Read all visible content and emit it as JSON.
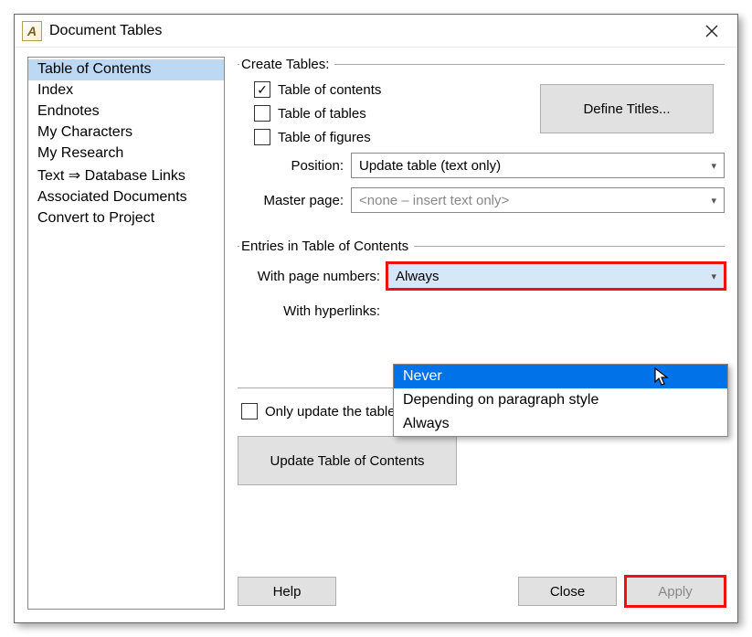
{
  "window": {
    "title": "Document Tables"
  },
  "sidebar": {
    "items": [
      {
        "label": "Table of Contents",
        "selected": true
      },
      {
        "label": "Index"
      },
      {
        "label": "Endnotes"
      },
      {
        "label": "My Characters"
      },
      {
        "label": "My Research"
      },
      {
        "label": "Text ⇒ Database Links"
      },
      {
        "label": "Associated Documents"
      },
      {
        "label": "Convert to Project"
      }
    ]
  },
  "create": {
    "legend": "Create Tables:",
    "toc": {
      "label": "Table of contents",
      "checked": true
    },
    "tot": {
      "label": "Table of tables",
      "checked": false
    },
    "tof": {
      "label": "Table of figures",
      "checked": false
    },
    "define": "Define Titles...",
    "position_label": "Position:",
    "position_value": "Update table (text only)",
    "master_label": "Master page:",
    "master_value": "<none – insert text only>"
  },
  "entries": {
    "legend": "Entries in Table of Contents",
    "pagenum_label": "With page numbers:",
    "pagenum_value": "Always",
    "hyper_label": "With hyperlinks:",
    "dropdown": {
      "options": [
        "Never",
        "Depending on paragraph style",
        "Always"
      ],
      "hover_index": 0
    }
  },
  "update": {
    "only_label": "Only update the tables by user action (not automatically)",
    "only_checked": false,
    "button": "Update Table of Contents"
  },
  "footer": {
    "help": "Help",
    "close": "Close",
    "apply": "Apply"
  }
}
